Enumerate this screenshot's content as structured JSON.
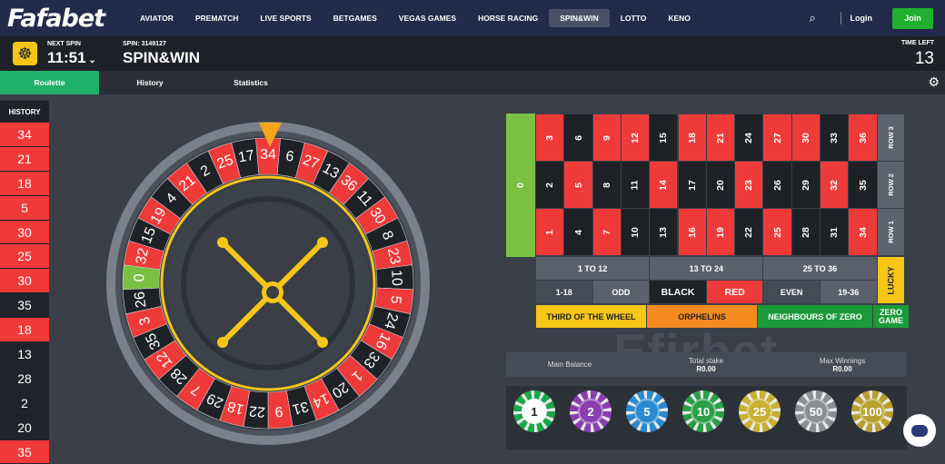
{
  "nav": {
    "logo": "Fafabet",
    "items": [
      "AVIATOR",
      "PREMATCH",
      "LIVE SPORTS",
      "BETGAMES",
      "VEGAS GAMES",
      "HORSE RACING",
      "SPIN&WIN",
      "LOTTO",
      "KENO"
    ],
    "active": "SPIN&WIN",
    "login": "Login",
    "join": "Join"
  },
  "spin": {
    "next_label": "NEXT SPIN",
    "next_time": "11:51",
    "spin_label": "SPIN: 3149127",
    "title": "SPIN&WIN",
    "time_label": "TIME LEFT",
    "time_left": "13"
  },
  "tabs": [
    "Roulette",
    "History",
    "Statistics"
  ],
  "history": {
    "title": "HISTORY",
    "items": [
      {
        "n": "34",
        "c": "red"
      },
      {
        "n": "21",
        "c": "red"
      },
      {
        "n": "18",
        "c": "red"
      },
      {
        "n": "5",
        "c": "red"
      },
      {
        "n": "30",
        "c": "red"
      },
      {
        "n": "25",
        "c": "red"
      },
      {
        "n": "30",
        "c": "red"
      },
      {
        "n": "35",
        "c": "black"
      },
      {
        "n": "18",
        "c": "red"
      },
      {
        "n": "13",
        "c": "black"
      },
      {
        "n": "28",
        "c": "black"
      },
      {
        "n": "2",
        "c": "black"
      },
      {
        "n": "20",
        "c": "black"
      },
      {
        "n": "35",
        "c": "red"
      }
    ]
  },
  "wheel": {
    "order": [
      "34",
      "6",
      "27",
      "13",
      "36",
      "11",
      "30",
      "8",
      "23",
      "10",
      "5",
      "24",
      "16",
      "33",
      "1",
      "20",
      "14",
      "31",
      "9",
      "22",
      "18",
      "29",
      "7",
      "28",
      "12",
      "35",
      "3",
      "26",
      "0",
      "32",
      "15",
      "19",
      "4",
      "21",
      "2",
      "25",
      "17"
    ]
  },
  "board": {
    "zero": "0",
    "rows": [
      [
        "3",
        "6",
        "9",
        "12",
        "15",
        "18",
        "21",
        "24",
        "27",
        "30",
        "33",
        "36"
      ],
      [
        "2",
        "5",
        "8",
        "11",
        "14",
        "17",
        "20",
        "23",
        "26",
        "29",
        "32",
        "35"
      ],
      [
        "1",
        "4",
        "7",
        "10",
        "13",
        "16",
        "19",
        "22",
        "25",
        "28",
        "31",
        "34"
      ]
    ],
    "row_labels": [
      "ROW 3",
      "ROW 2",
      "ROW 1"
    ],
    "dozens": [
      "1 TO 12",
      "13 TO 24",
      "25 TO 36"
    ],
    "outside": [
      "1-18",
      "ODD",
      "BLACK",
      "RED",
      "EVEN",
      "19-36"
    ],
    "lucky": "LUCKY",
    "sectors": [
      "THIRD OF THE WHEEL",
      "ORPHELINS",
      "NEIGHBOURS OF ZERO",
      "ZERO GAME"
    ]
  },
  "balance": {
    "main_label": "Main Balance",
    "stake_label": "Total stake",
    "stake": "R0.00",
    "win_label": "Max Winnings",
    "win": "R0.00"
  },
  "watermark": "Efirbet",
  "chips": [
    "1",
    "2",
    "5",
    "10",
    "25",
    "50",
    "100"
  ],
  "colors": {
    "red": "#ef3a3a",
    "black": "#1e2125",
    "green": "#7ac143",
    "accent": "#1fb02f"
  }
}
